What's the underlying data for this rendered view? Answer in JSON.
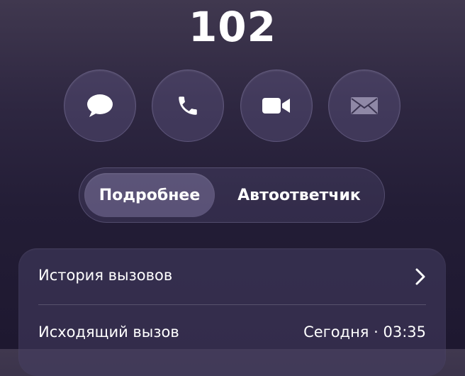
{
  "contact": {
    "name": "102"
  },
  "actions": [
    {
      "icon": "message-bubble-icon"
    },
    {
      "icon": "phone-icon"
    },
    {
      "icon": "video-camera-icon"
    },
    {
      "icon": "mail-icon"
    }
  ],
  "segmented": {
    "tabs": [
      {
        "label": "Подробнее",
        "selected": true
      },
      {
        "label": "Автоответчик",
        "selected": false
      }
    ]
  },
  "details": {
    "history_label": "История вызовов",
    "chevron_icon": "chevron-right-icon",
    "call_type": "Исходящий вызов",
    "call_time": "Сегодня · 03:35"
  },
  "colors": {
    "text": "#ffffff",
    "accent_disabled": "#8f88a6"
  }
}
